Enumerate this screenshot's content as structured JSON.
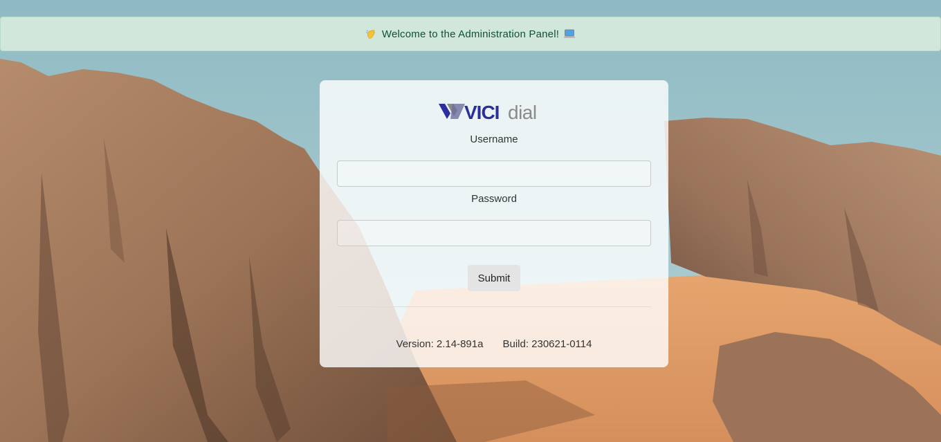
{
  "banner": {
    "text": "Welcome to the Administration Panel!",
    "leading_icon": "waving-hand-icon",
    "trailing_icon": "laptop-icon"
  },
  "login": {
    "logo_alt": "VICIdial",
    "username_label": "Username",
    "username_value": "",
    "password_label": "Password",
    "password_value": "",
    "submit_label": "Submit"
  },
  "footer": {
    "version": "Version: 2.14-891a",
    "build": "Build: 230621-0114"
  },
  "colors": {
    "banner_bg": "#d1e7dc",
    "banner_text": "#0f5132",
    "logo_blue": "#2b2f9e",
    "logo_gray": "#8a8a8a"
  }
}
